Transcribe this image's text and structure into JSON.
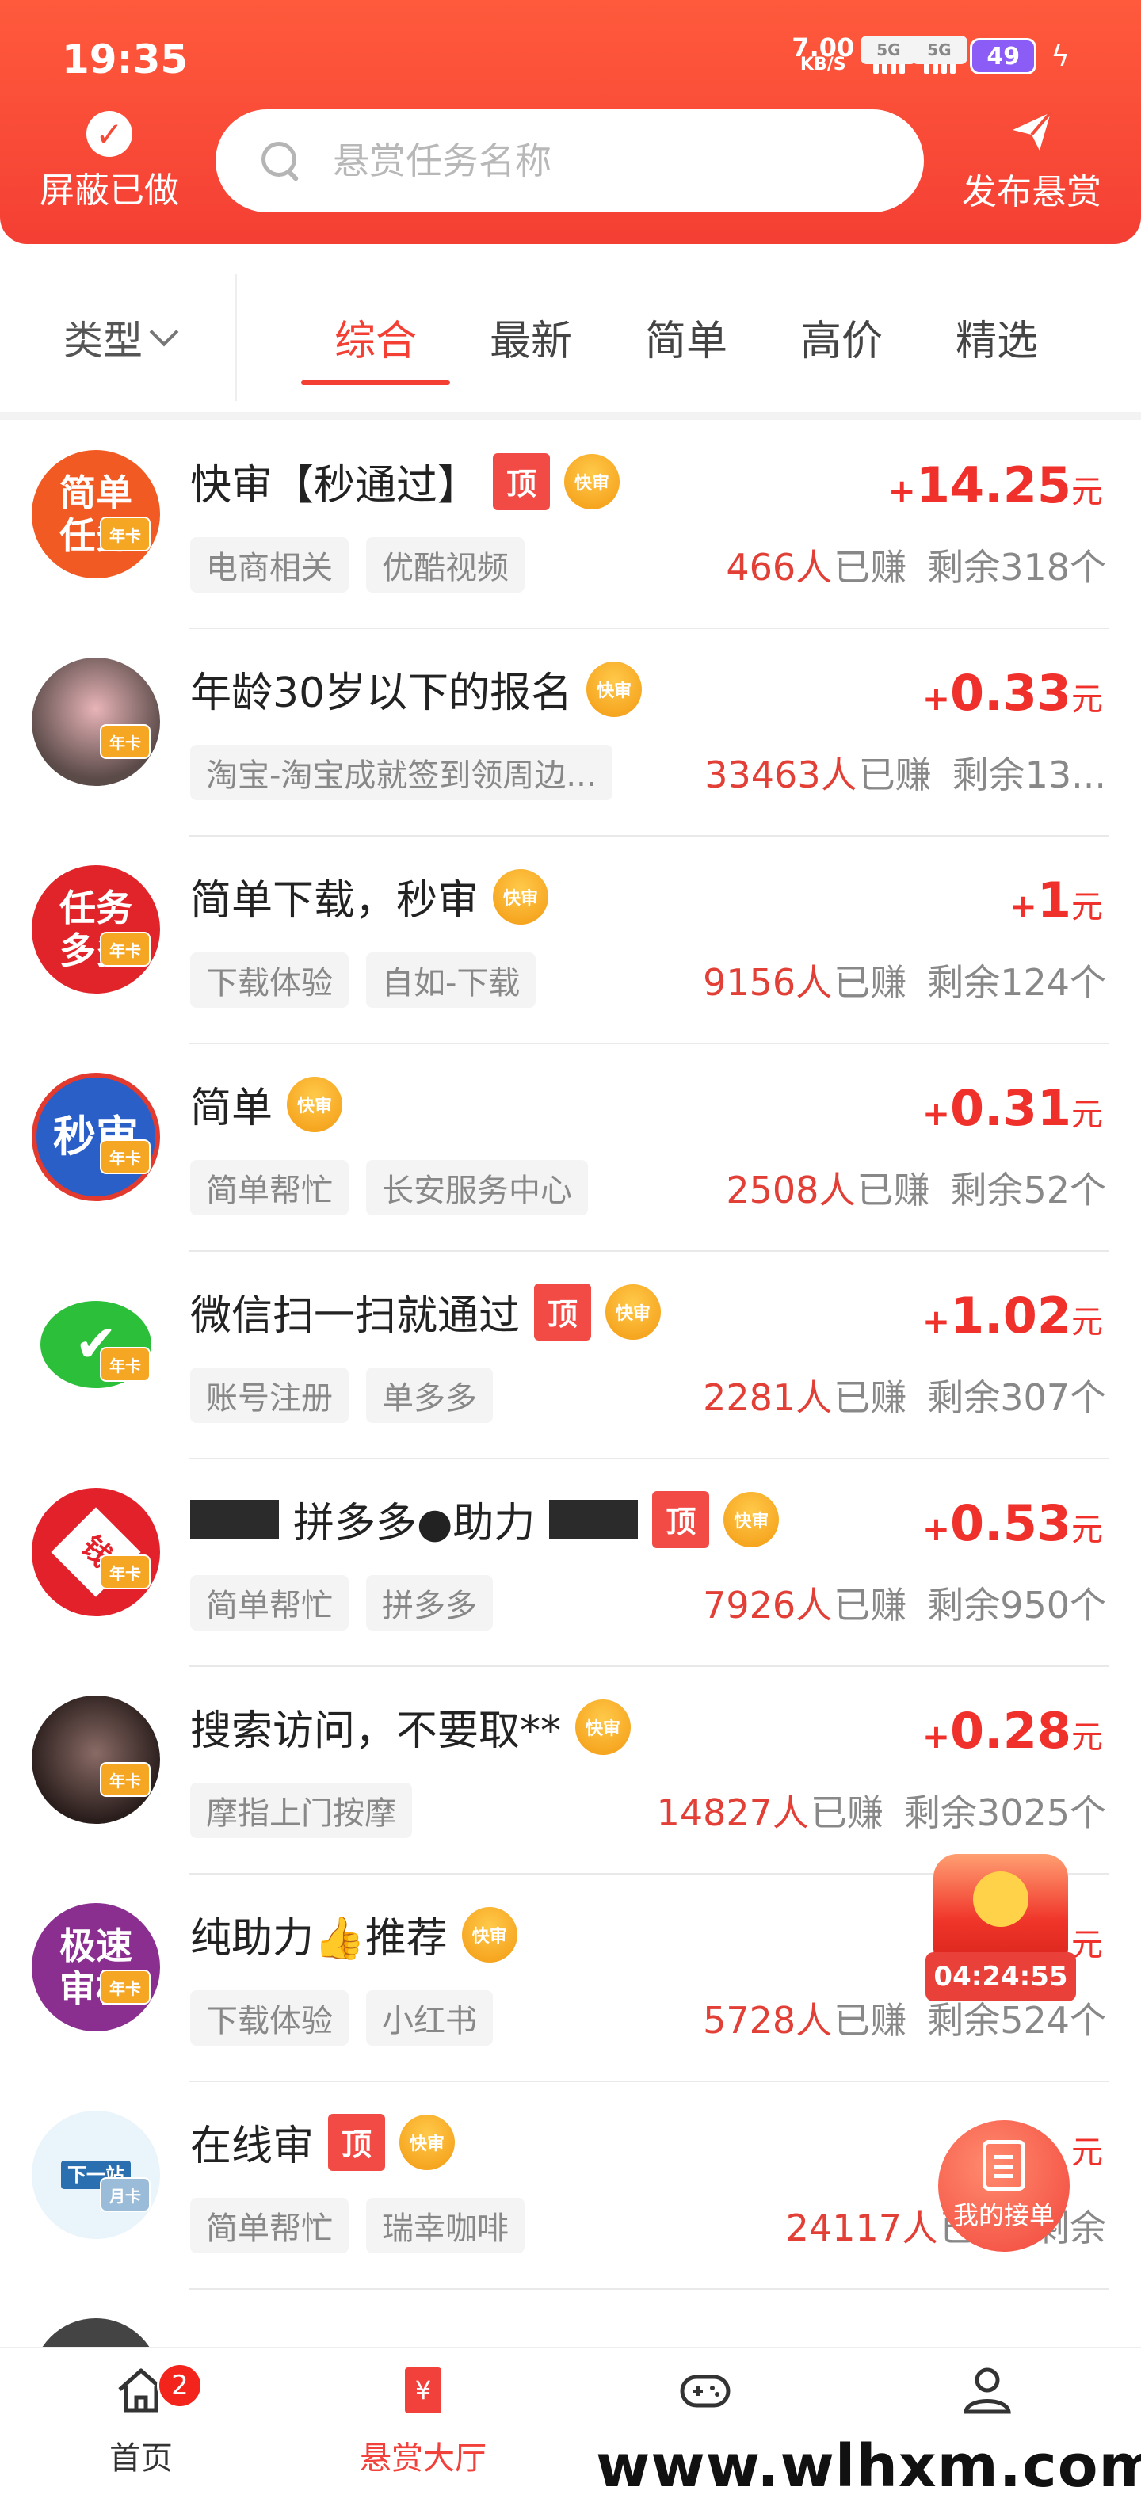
{
  "status_bar": {
    "time": "19:35",
    "net_speed_value": "7.00",
    "net_speed_unit": "KB/S",
    "signal1_label": "5G",
    "signal2_label": "5G",
    "battery": "49"
  },
  "header": {
    "hide_done_label": "屏蔽已做",
    "search_placeholder": "悬赏任务名称",
    "publish_label": "发布悬赏"
  },
  "filter": {
    "type_label": "类型",
    "tabs": [
      {
        "label": "综合",
        "active": true
      },
      {
        "label": "最新",
        "active": false
      },
      {
        "label": "简单",
        "active": false
      },
      {
        "label": "高价",
        "active": false
      },
      {
        "label": "精选",
        "active": false
      }
    ]
  },
  "badges": {
    "top": "顶",
    "fast": "快审",
    "year": "年卡",
    "month": "月卡"
  },
  "tasks": [
    {
      "avatar_text": "简单任务",
      "avatar_color": "#f15a22",
      "title": "快审【秒通过】",
      "has_top": true,
      "has_fast": true,
      "price_sign": "+",
      "price": "14.25",
      "unit": "元",
      "tags": [
        "电商相关",
        "优酷视频"
      ],
      "earned": "466人",
      "earned_suffix": "已赚",
      "remaining": "剩余318个"
    },
    {
      "avatar_text": "",
      "avatar_color": "#7c6a6a",
      "title": "年龄30岁以下的报名",
      "has_top": false,
      "has_fast": true,
      "price_sign": "+",
      "price": "0.33",
      "unit": "元",
      "tags": [
        "淘宝-淘宝成就签到领周边..."
      ],
      "earned": "33463人",
      "earned_suffix": "已赚",
      "remaining": "剩余13..."
    },
    {
      "avatar_text": "任务多多",
      "avatar_color": "#e0242a",
      "title": "简单下载，秒审",
      "has_top": false,
      "has_fast": true,
      "price_sign": "+",
      "price": "1",
      "unit": "元",
      "tags": [
        "下载体验",
        "自如-下载"
      ],
      "earned": "9156人",
      "earned_suffix": "已赚",
      "remaining": "剩余124个"
    },
    {
      "avatar_text": "秒审",
      "avatar_color": "#2a5fc8",
      "title": "简单",
      "has_top": false,
      "has_fast": true,
      "price_sign": "+",
      "price": "0.31",
      "unit": "元",
      "tags": [
        "简单帮忙",
        "长安服务中心"
      ],
      "earned": "2508人",
      "earned_suffix": "已赚",
      "remaining": "剩余52个"
    },
    {
      "avatar_text": "✔",
      "avatar_color": "#2bbf3a",
      "title": "微信扫一扫就通过",
      "has_top": true,
      "has_fast": true,
      "price_sign": "+",
      "price": "1.02",
      "unit": "元",
      "tags": [
        "账号注册",
        "单多多"
      ],
      "earned": "2281人",
      "earned_suffix": "已赚",
      "remaining": "剩余307个"
    },
    {
      "avatar_text": "钱",
      "avatar_color": "#e3212b",
      "title_mid": "拼多多●助力",
      "redacted": true,
      "has_top": true,
      "has_fast": true,
      "price_sign": "+",
      "price": "0.53",
      "unit": "元",
      "tags": [
        "简单帮忙",
        "拼多多"
      ],
      "earned": "7926人",
      "earned_suffix": "已赚",
      "remaining": "剩余950个"
    },
    {
      "avatar_text": "",
      "avatar_color": "#3a2a28",
      "title": "搜索访问，不要取**",
      "has_top": false,
      "has_fast": true,
      "price_sign": "+",
      "price": "0.28",
      "unit": "元",
      "tags": [
        "摩指上门按摩"
      ],
      "earned": "14827人",
      "earned_suffix": "已赚",
      "remaining": "剩余3025个"
    },
    {
      "avatar_text": "极速审核",
      "avatar_color": "#8a2e8f",
      "title": "纯助力👍推荐",
      "has_top": false,
      "has_fast": true,
      "price_sign": "",
      "price": "",
      "unit": "元",
      "tags": [
        "下载体验",
        "小红书"
      ],
      "earned": "5728人",
      "earned_suffix": "已赚",
      "remaining": "剩余524个"
    },
    {
      "avatar_text": "下一站",
      "avatar_color": "#eaf4fb",
      "title": "在线审",
      "has_top": true,
      "has_fast": true,
      "price_sign": "",
      "price": "",
      "unit": "元",
      "tags": [
        "简单帮忙",
        "瑞幸咖啡"
      ],
      "earned": "24117人",
      "earned_suffix": "已赚",
      "remaining": "剩余"
    }
  ],
  "floating": {
    "countdown": "04:24:55",
    "my_orders_label": "我的接单"
  },
  "bottom_nav": {
    "items": [
      {
        "label": "首页",
        "badge": "2"
      },
      {
        "label": "悬赏大厅"
      },
      {
        "label": ""
      },
      {
        "label": ""
      }
    ]
  },
  "watermark": "www.wlhxm.com"
}
